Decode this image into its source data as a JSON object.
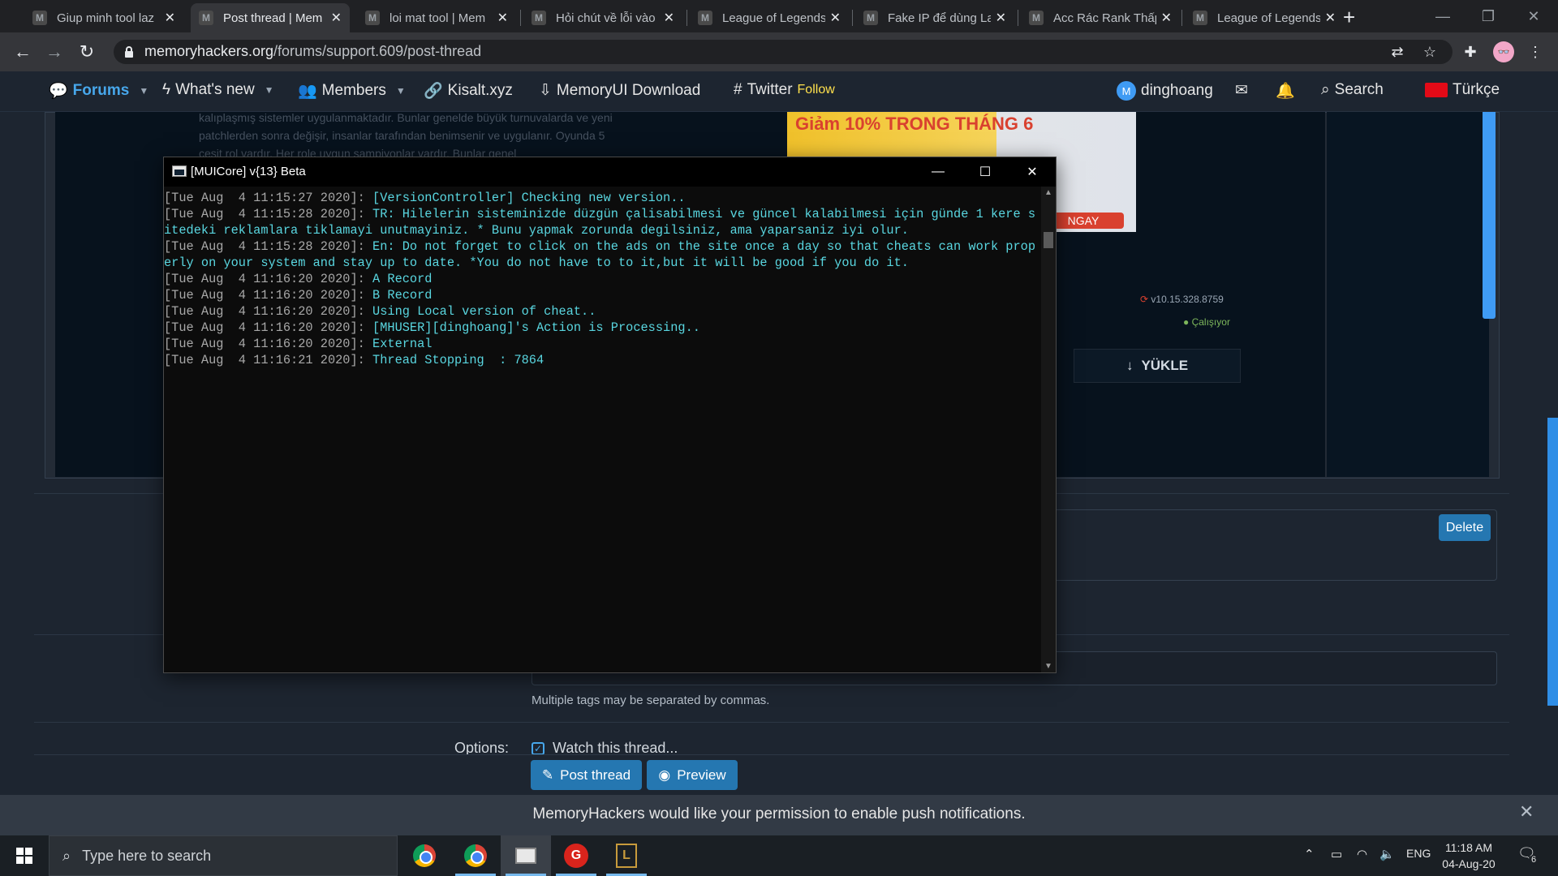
{
  "browser": {
    "tabs": [
      {
        "title": "Giup minh tool laz",
        "active": false
      },
      {
        "title": "Post thread | Mem",
        "active": true
      },
      {
        "title": "loi mat tool | Mem",
        "active": false
      },
      {
        "title": "Hỏi chút về lỗi vào",
        "active": false
      },
      {
        "title": "League of Legends",
        "active": false
      },
      {
        "title": "Fake IP để dùng La",
        "active": false
      },
      {
        "title": "Acc Rác Rank Thấp",
        "active": false
      },
      {
        "title": "League of Legends",
        "active": false
      }
    ],
    "tab_favicon": "M",
    "tab_close": "✕",
    "new_tab": "+",
    "url_host": "memoryhackers.org",
    "url_path": "/forums/support.609/post-thread",
    "profile_initials": "👓"
  },
  "site_nav": {
    "forums": "Forums",
    "whats_new": "What's new",
    "members": "Members",
    "kisalt": "Kisalt.xyz",
    "memoryui": "MemoryUI Download",
    "twitter": "Twitter",
    "twitter_follow": "Follow",
    "username": "dinghoang",
    "search": "Search",
    "language": "Türkçe"
  },
  "background_page": {
    "blur_text": "kalıplaşmış sistemler uygulanmaktadır. Bunlar genelde büyük turnuvalarda ve yeni patchlerden sonra değişir, insanlar tarafından benimsenir ve uygulanır. Oyunda 5 çeşit rol vardır. Her role uygun şampiyonlar vardır. Bunlar genel",
    "ad_text": "Giảm 10% TRONG THÁNG 6",
    "ad_banner": "NGAY",
    "version": "v10.15.328.8759",
    "running": "Çalışıyor",
    "load_button": "YÜKLE",
    "delete_button": "Delete",
    "tags_hint": "Multiple tags may be separated by commas.",
    "options_label": "Options:",
    "watch_thread": "Watch this thread...",
    "post_thread": "Post thread",
    "preview": "Preview",
    "push_message": "MemoryHackers would like your permission to enable push notifications."
  },
  "console": {
    "title": "[MUICore] v{13} Beta",
    "lines": [
      {
        "ts": "[Tue Aug  4 11:15:27 2020]: ",
        "msg": "[VersionController] Checking new version.."
      },
      {
        "ts": "[Tue Aug  4 11:15:28 2020]: ",
        "msg": "TR: Hilelerin sisteminizde düzgün çalisabilmesi ve güncel kalabilmesi için günde 1 kere sitedeki reklamlara tiklamayi unutmayiniz. * Bunu yapmak zorunda degilsiniz, ama yaparsaniz iyi olur."
      },
      {
        "ts": "[Tue Aug  4 11:15:28 2020]: ",
        "msg": "En: Do not forget to click on the ads on the site once a day so that cheats can work properly on your system and stay up to date. *You do not have to to it,but it will be good if you do it."
      },
      {
        "ts": "[Tue Aug  4 11:16:20 2020]: ",
        "msg": "A Record"
      },
      {
        "ts": "[Tue Aug  4 11:16:20 2020]: ",
        "msg": "B Record"
      },
      {
        "ts": "[Tue Aug  4 11:16:20 2020]: ",
        "msg": "Using Local version of cheat.."
      },
      {
        "ts": "[Tue Aug  4 11:16:20 2020]: ",
        "msg": "[MHUSER][dinghoang]'s Action is Processing.."
      },
      {
        "ts": "[Tue Aug  4 11:16:20 2020]: ",
        "msg": "External"
      },
      {
        "ts": "[Tue Aug  4 11:16:21 2020]: ",
        "msg": "Thread Stopping  : 7864"
      }
    ]
  },
  "taskbar": {
    "search_placeholder": "Type here to search",
    "language": "ENG",
    "time": "11:18 AM",
    "date": "04-Aug-20",
    "notification_count": "6"
  },
  "colors": {
    "accent": "#47a7eb",
    "button": "#2577b1",
    "console_text": "#59d6e0"
  }
}
